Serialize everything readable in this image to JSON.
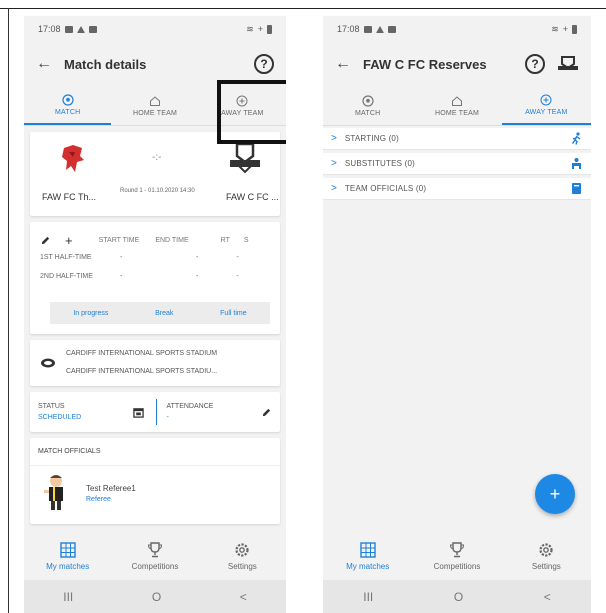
{
  "left": {
    "status_bar": {
      "time": "17:08"
    },
    "app_bar": {
      "title": "Match details",
      "help_label": "?"
    },
    "tabs": [
      {
        "label": "MATCH",
        "icon": "soccer-ball-icon",
        "active": true
      },
      {
        "label": "HOME TEAM",
        "icon": "home-icon",
        "active": false
      },
      {
        "label": "AWAY TEAM",
        "icon": "away-icon",
        "active": false
      }
    ],
    "match": {
      "home_team": "FAW FC Th...",
      "away_team": "FAW C FC ...",
      "round": "Round 1 - 01.10.2020 14:30"
    },
    "times": {
      "plus": "+",
      "headers": [
        "START TIME",
        "END TIME",
        "RT",
        "S"
      ],
      "rows": [
        {
          "label": "1ST HALF-TIME",
          "start": "-",
          "end": "-",
          "rt": "-"
        },
        {
          "label": "2ND HALF-TIME",
          "start": "-",
          "end": "-",
          "rt": "-"
        }
      ],
      "buttons": [
        "In progress",
        "Break",
        "Full time"
      ]
    },
    "stadium": {
      "line1": "CARDIFF INTERNATIONAL SPORTS STADIUM",
      "line2": "CARDIFF INTERNATIONAL SPORTS STADIU..."
    },
    "status": {
      "status_label": "STATUS",
      "status_value": "SCHEDULED",
      "attendance_label": "ATTENDANCE",
      "attendance_value": "-"
    },
    "officials": {
      "heading": "MATCH OFFICIALS",
      "name": "Test Referee1",
      "role": "Referee"
    }
  },
  "right": {
    "status_bar": {
      "time": "17:08"
    },
    "app_bar": {
      "title": "FAW C FC Reserves",
      "help_label": "?"
    },
    "tabs": [
      {
        "label": "MATCH",
        "icon": "soccer-ball-icon",
        "active": false
      },
      {
        "label": "HOME TEAM",
        "icon": "home-icon",
        "active": false
      },
      {
        "label": "AWAY TEAM",
        "icon": "away-icon",
        "active": true
      }
    ],
    "sections": [
      {
        "label": "STARTING (0)",
        "icon": "running-player-icon"
      },
      {
        "label": "SUBSTITUTES (0)",
        "icon": "bench-icon"
      },
      {
        "label": "TEAM OFFICIALS (0)",
        "icon": "clipboard-icon"
      }
    ],
    "fab_label": "+"
  },
  "bottom_nav": [
    {
      "label": "My matches",
      "icon": "calendar-grid-icon",
      "active": true
    },
    {
      "label": "Competitions",
      "icon": "trophy-icon",
      "active": false
    },
    {
      "label": "Settings",
      "icon": "gear-icon",
      "active": false
    }
  ],
  "system_nav": {
    "recents": "III",
    "home": "O",
    "back": "<"
  },
  "colors": {
    "accent": "#1e7fd6",
    "fab": "#1e88e5",
    "background": "#f2f2f2"
  }
}
